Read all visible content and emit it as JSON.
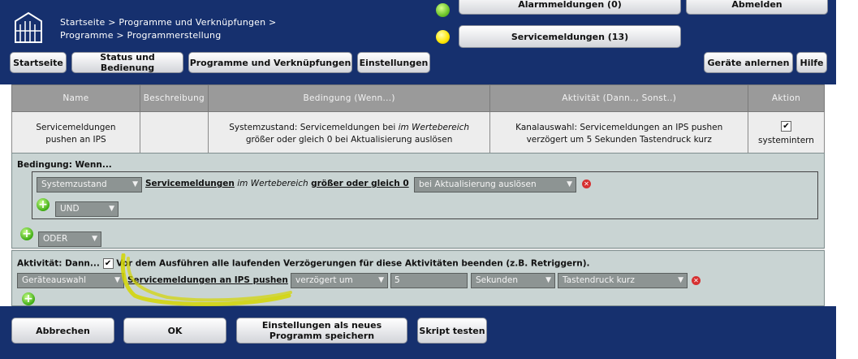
{
  "header": {
    "breadcrumb_line1": "Startseite > Programme und Verknüpfungen >",
    "breadcrumb_line2": "Programme > Programmerstellung",
    "alarm_label": "Alarmmeldungen (0)",
    "service_label": "Servicemeldungen (13)",
    "logout_label": "Abmelden",
    "indicator_colors": {
      "alarm": "#6dc52b",
      "service": "#ffe600"
    }
  },
  "nav": {
    "home": "Startseite",
    "status": "Status und Bedienung",
    "programs": "Programme und Verknüpfungen",
    "settings": "Einstellungen",
    "teach": "Geräte anlernen",
    "help": "Hilfe"
  },
  "table": {
    "headers": [
      "Name",
      "Beschreibung",
      "Bedingung (Wenn...)",
      "Aktivität (Dann.., Sonst..)",
      "Aktion"
    ],
    "row": {
      "name_line1": "Servicemeldungen",
      "name_line2": "pushen an IPS",
      "description": "",
      "condition_pre": "Systemzustand: Servicemeldungen bei ",
      "condition_em": "im Wertebereich",
      "condition_line2": "größer oder gleich 0 bei Aktualisierung auslösen",
      "activity_line1": "Kanalauswahl: Servicemeldungen an IPS pushen",
      "activity_line2": "verzögert um 5 Sekunden Tastendruck kurz",
      "action_checked": "✔",
      "action_label": "systemintern"
    }
  },
  "condition": {
    "title": "Bedingung: Wenn...",
    "source_select": "Systemzustand",
    "object_link": "Servicemeldungen",
    "range_text": "im Wertebereich",
    "comparison_link": "größer oder gleich 0",
    "trigger_select": "bei Aktualisierung auslösen",
    "and_select": "UND",
    "or_select": "ODER"
  },
  "activity": {
    "title": "Aktivität: Dann...",
    "checkbox_mark": "✔",
    "checkbox_label": "Vor dem Ausführen alle laufenden Verzögerungen für diese Aktivitäten beenden (z.B. Retriggern).",
    "device_select": "Geräteauswahl",
    "target_link": "Servicemeldungen an IPS pushen",
    "delay_select": "verzögert um",
    "delay_value": "5",
    "unit_select": "Sekunden",
    "action_select": "Tastendruck kurz"
  },
  "footer": {
    "cancel": "Abbrechen",
    "ok": "OK",
    "save_line1": "Einstellungen als neues",
    "save_line2": "Programm speichern",
    "test": "Skript testen"
  },
  "icons": {
    "add": "plus-icon",
    "delete": "delete-icon",
    "logo": "house-logo-icon"
  },
  "highlight_color": "#d4d600"
}
